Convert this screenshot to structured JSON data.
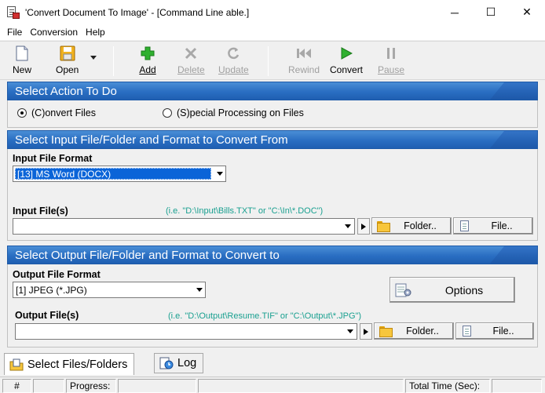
{
  "window": {
    "title": "'Convert Document To Image' - [Command Line able.]",
    "controls": {
      "minimize": "─",
      "maximize": "☐",
      "close": "✕"
    }
  },
  "menu": [
    "File",
    "Conversion",
    "Help"
  ],
  "toolbar": {
    "new": "New",
    "open": "Open",
    "add": "Add",
    "delete": "Delete",
    "update": "Update",
    "rewind": "Rewind",
    "convert": "Convert",
    "pause": "Pause"
  },
  "action_section": {
    "title": "Select Action To Do",
    "convert_files": "(C)onvert Files",
    "special_processing": "(S)pecial Processing on Files",
    "selected": "convert_files"
  },
  "input_section": {
    "title": "Select Input File/Folder and Format to Convert From",
    "format_label": "Input File Format",
    "format_value": "[13] MS Word (DOCX)",
    "files_label": "Input File(s)",
    "files_hint": "(i.e. \"D:\\Input\\Bills.TXT\" or \"C:\\In\\*.DOC\")",
    "files_value": "",
    "folder_button": "Folder..",
    "file_button": "File.."
  },
  "output_section": {
    "title": "Select Output File/Folder and Format to Convert to",
    "format_label": "Output File Format",
    "format_value": "[1] JPEG (*.JPG)",
    "options_button": "Options",
    "files_label": "Output File(s)",
    "files_hint": "(i.e. \"D:\\Output\\Resume.TIF\" or \"C:\\Output\\*.JPG\")",
    "files_value": "",
    "folder_button": "Folder..",
    "file_button": "File.."
  },
  "tabs": [
    "Select Files/Folders",
    "Log"
  ],
  "status": {
    "hash": "#",
    "progress": "Progress:",
    "total_time": "Total Time (Sec):"
  },
  "colors": {
    "section_header": "#2a6ec2",
    "hint_text": "#1aa090",
    "selection": "#0a64d8"
  }
}
